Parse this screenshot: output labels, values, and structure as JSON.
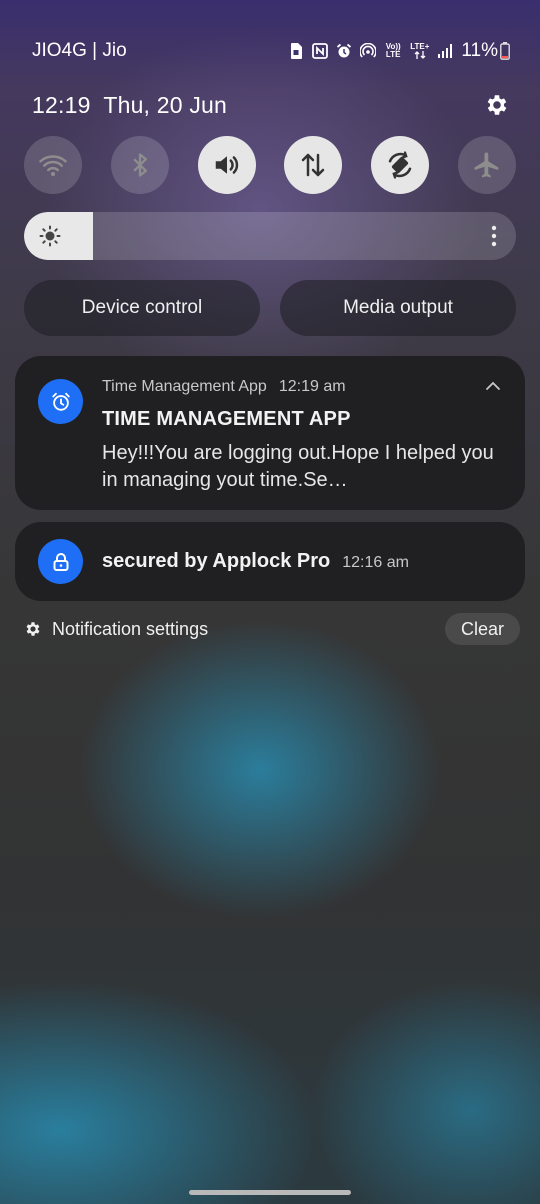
{
  "status_bar": {
    "carrier": "JIO4G | Jio",
    "volte": "Vo)) LTE",
    "network": "LTE+",
    "battery": "11%",
    "icons": [
      "sim-icon",
      "nfc-icon",
      "alarm-icon",
      "hotspot-icon",
      "volte-icon",
      "lte-icon",
      "signal-icon",
      "battery-icon"
    ]
  },
  "header": {
    "time": "12:19",
    "date": "Thu, 20 Jun",
    "settings_icon": "gear-icon"
  },
  "quick_settings": {
    "tiles": [
      {
        "icon": "wifi-icon",
        "on": false
      },
      {
        "icon": "bluetooth-icon",
        "on": false
      },
      {
        "icon": "sound-icon",
        "on": true
      },
      {
        "icon": "mobile-data-icon",
        "on": true
      },
      {
        "icon": "auto-rotate-icon",
        "on": true
      },
      {
        "icon": "airplane-mode-icon",
        "on": false
      }
    ],
    "brightness_level": 0.14,
    "buttons": {
      "device_control": "Device control",
      "media_output": "Media output"
    }
  },
  "notifications": [
    {
      "app": "Time Management App",
      "time": "12:19 am",
      "title": "TIME MANAGEMENT APP",
      "body": "Hey!!!You are logging out.Hope I helped you in managing yout time.Se…",
      "icon": "alarm-icon",
      "icon_color": "#1e6ff5"
    },
    {
      "title": "secured by Applock Pro",
      "time": "12:16 am",
      "icon": "lock-icon",
      "icon_color": "#1e6ff5"
    }
  ],
  "footer": {
    "notification_settings": "Notification settings",
    "clear": "Clear"
  }
}
